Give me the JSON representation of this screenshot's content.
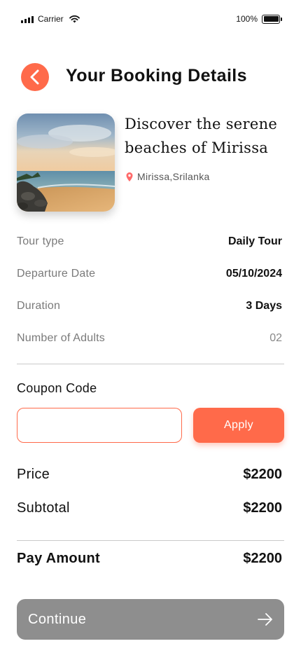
{
  "status_bar": {
    "carrier": "Carrier",
    "battery_text": "100%",
    "battery_level": 1.0
  },
  "header": {
    "title": "Your Booking Details",
    "back_icon": "chevron-left-icon"
  },
  "tour": {
    "title": "Discover the serene beaches of Mirissa",
    "location": "Mirissa,Srilanka",
    "location_icon": "map-pin-icon"
  },
  "details": [
    {
      "label": "Tour type",
      "value": "Daily Tour"
    },
    {
      "label": "Departure Date",
      "value": "05/10/2024"
    },
    {
      "label": "Duration",
      "value": "3 Days"
    },
    {
      "label": "Number of Adults",
      "value": "02"
    }
  ],
  "coupon": {
    "label": "Coupon Code",
    "value": "",
    "placeholder": "",
    "apply_label": "Apply"
  },
  "pricing": {
    "price_label": "Price",
    "price_value": "$2200",
    "subtotal_label": "Subtotal",
    "subtotal_value": "$2200",
    "pay_label": "Pay Amount",
    "pay_value": "$2200"
  },
  "footer": {
    "continue_label": "Continue",
    "continue_icon": "arrow-right-icon"
  },
  "colors": {
    "accent": "#ff6a4a",
    "button_disabled": "#8e8e8e",
    "muted_text": "#7a7a7a"
  }
}
